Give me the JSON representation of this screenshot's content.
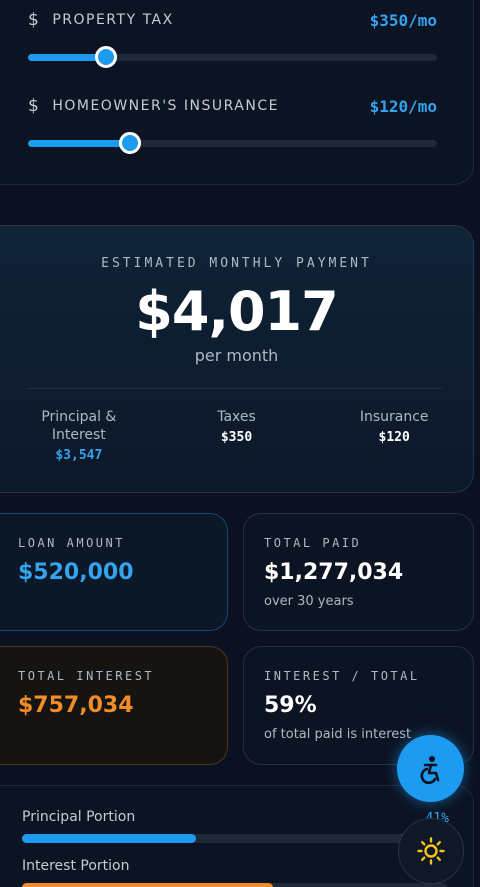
{
  "sliders": [
    {
      "label": "PROPERTY TAX",
      "icon": "dollar-icon",
      "symbol": "$",
      "value": "$350/mo",
      "fraction": 0.19
    },
    {
      "label": "HOMEOWNER'S INSURANCE",
      "icon": "dollar-icon",
      "symbol": "$",
      "value": "$120/mo",
      "fraction": 0.25
    }
  ],
  "payment": {
    "title": "ESTIMATED MONTHLY PAYMENT",
    "amount": "$4,017",
    "period": "per month",
    "breakdown": [
      {
        "label": "Principal & Interest",
        "value": "$3,547"
      },
      {
        "label": "Taxes",
        "value": "$350"
      },
      {
        "label": "Insurance",
        "value": "$120"
      }
    ]
  },
  "stats": {
    "loan_amount": {
      "label": "LOAN AMOUNT",
      "value": "$520,000"
    },
    "total_paid": {
      "label": "TOTAL PAID",
      "value": "$1,277,034",
      "note": "over 30 years"
    },
    "total_interest": {
      "label": "TOTAL INTEREST",
      "value": "$757,034"
    },
    "interest_ratio": {
      "label": "INTEREST / TOTAL",
      "value": "59%",
      "note": "of total paid is interest"
    }
  },
  "portions": {
    "principal": {
      "label": "Principal Portion",
      "pct": "41%",
      "fraction": 0.41
    },
    "interest": {
      "label": "Interest Portion",
      "fraction": 0.59
    }
  },
  "colors": {
    "accent": "#1d9bf0",
    "interest": "#f28c28",
    "background": "#0b1120"
  },
  "buttons": {
    "accessibility": "accessibility-icon",
    "theme": "sun-icon"
  }
}
